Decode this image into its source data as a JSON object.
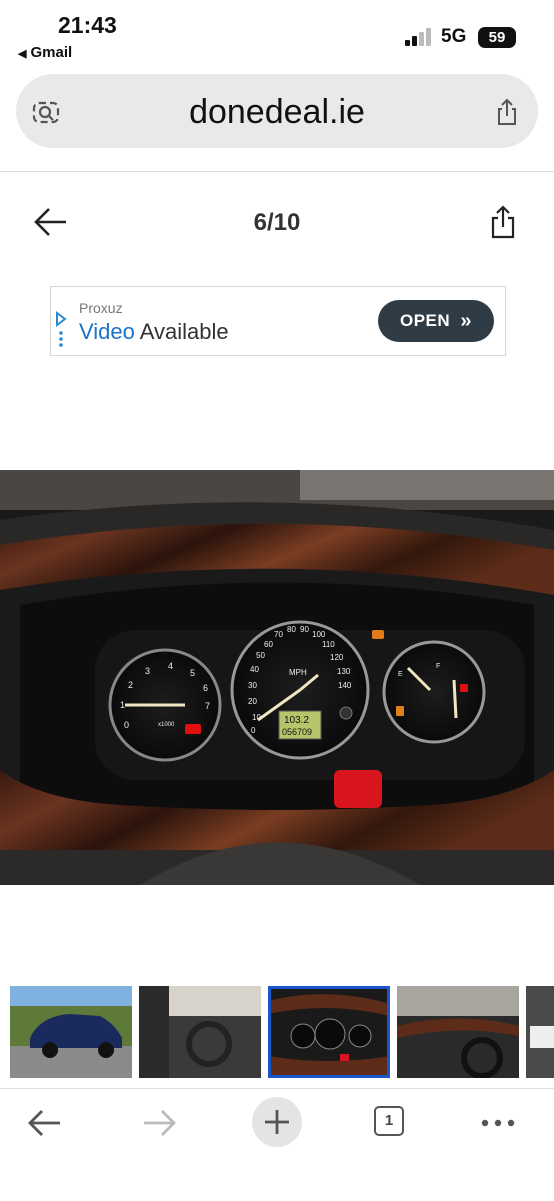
{
  "status_bar": {
    "time": "21:43",
    "back_app": "Gmail",
    "network": "5G",
    "battery": "59"
  },
  "browser": {
    "url": "donedeal.ie"
  },
  "gallery": {
    "counter": "6/10"
  },
  "ad": {
    "brand": "Proxuz",
    "headline_highlight": "Video",
    "headline_rest": " Available",
    "cta": "OPEN",
    "cta_icon": "double-chevron-right"
  },
  "photo": {
    "tach_ticks": [
      "0",
      "1",
      "2",
      "3",
      "4",
      "5",
      "6",
      "7"
    ],
    "tach_unit": "x1000",
    "speedo_unit": "MPH",
    "speedo_ticks": [
      "0",
      "10",
      "20",
      "30",
      "40",
      "50",
      "60",
      "70",
      "80",
      "90",
      "100",
      "110",
      "120",
      "130",
      "140"
    ],
    "odometer_trip": "103.2",
    "odometer_total": "056709",
    "fuel_labels": [
      "E",
      "F"
    ]
  },
  "thumbnails": {
    "count": 5,
    "selected_index": 2
  },
  "toolbar": {
    "tab_count": "1"
  },
  "colors": {
    "ad_button": "#2f3b45",
    "ad_highlight": "#1a73c9",
    "selected_thumb": "#1a55c9",
    "urlbar_bg": "#e9e9ec"
  }
}
